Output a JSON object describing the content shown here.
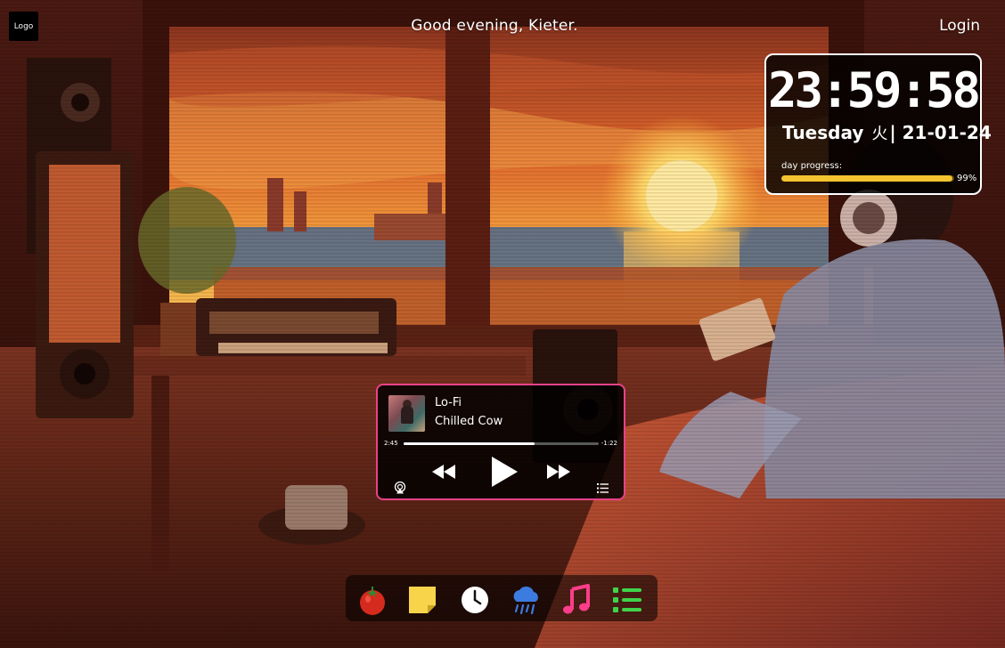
{
  "header": {
    "logo_text": "Logo",
    "greeting": "Good evening, Kieter.",
    "login_label": "Login"
  },
  "clock": {
    "time": "23:59:58",
    "weekday": "Tuesday",
    "kanji": "火",
    "separator": "|",
    "date": "21-01-24",
    "progress_label": "day progress:",
    "progress_value": 0.99,
    "progress_text": "99%"
  },
  "player": {
    "title": "Lo-Fi",
    "artist": "Chilled Cow",
    "elapsed": "2:45",
    "remaining": "-1:22",
    "seek_fraction": 0.67,
    "accent_color": "#e8428a",
    "icons": [
      "airplay-icon",
      "rewind-icon",
      "play-icon",
      "fast-forward-icon",
      "playlist-icon"
    ]
  },
  "dock": {
    "items": [
      {
        "name": "tomato-icon",
        "color": "#d42b1e"
      },
      {
        "name": "sticky-note-icon",
        "color": "#f7d44a"
      },
      {
        "name": "clock-icon",
        "color": "#ffffff"
      },
      {
        "name": "rain-cloud-icon",
        "color": "#3c7be0"
      },
      {
        "name": "music-note-icon",
        "color": "#ff3d8b"
      },
      {
        "name": "checklist-icon",
        "color": "#3fd44a"
      }
    ]
  }
}
